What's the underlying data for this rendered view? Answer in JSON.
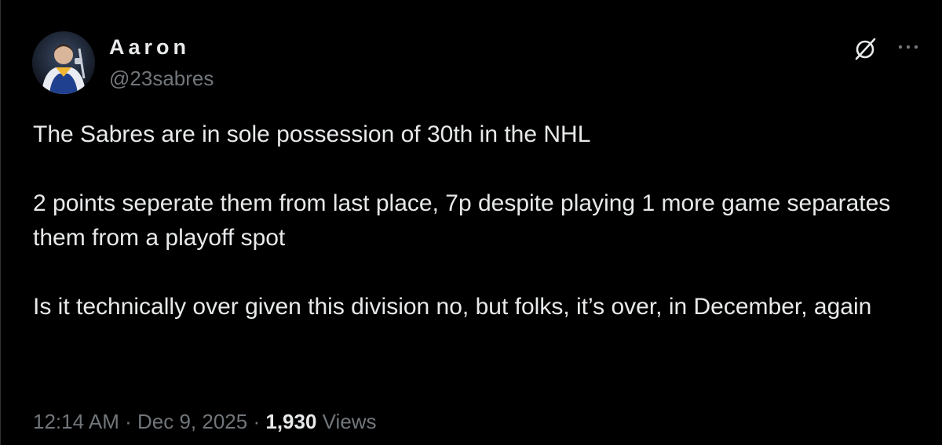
{
  "author": {
    "display_name": "Aaron",
    "handle": "@23sabres",
    "avatar": "avatar-photo"
  },
  "actions": {
    "grok_icon": "grok-icon",
    "more_icon": "more-icon"
  },
  "tweet": {
    "paragraphs": [
      "The Sabres are in sole possession of 30th in the NHL",
      "2 points seperate them from last place, 7p despite playing 1 more game separates them from a playoff spot",
      "Is it technically over given this division no, but folks, it’s over, in December, again"
    ],
    "time": "12:14 AM",
    "separator": "·",
    "date": "Dec 9, 2025",
    "views_count": "1,930",
    "views_label": "Views"
  },
  "colors": {
    "background": "#000000",
    "text_primary": "#e7e9ea",
    "text_secondary": "#71767b"
  }
}
